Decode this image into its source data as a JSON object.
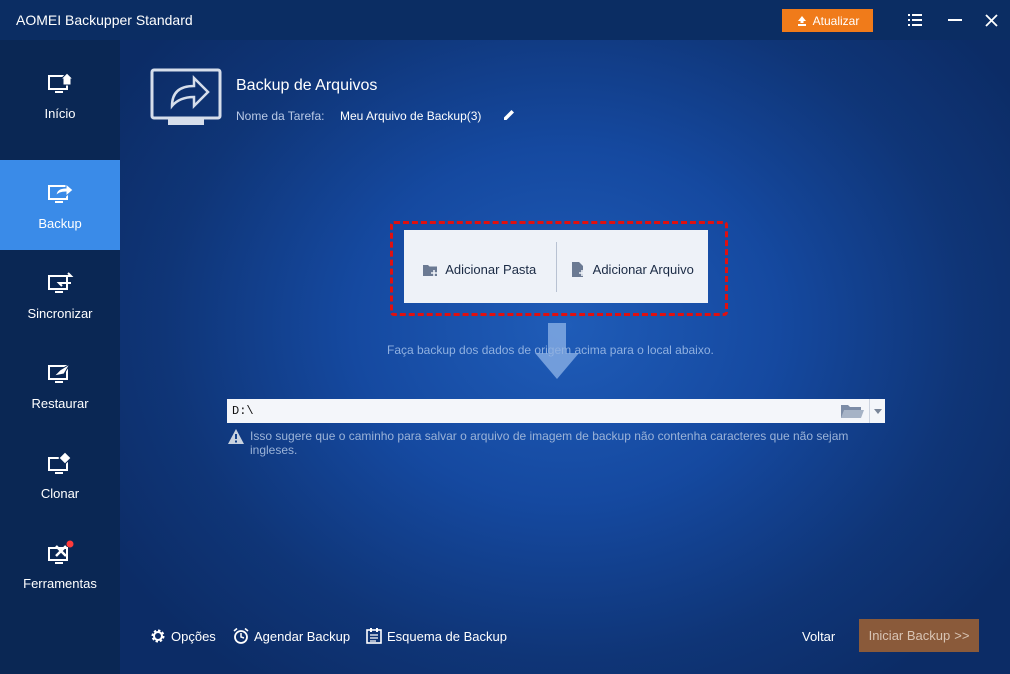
{
  "titlebar": {
    "app_title": "AOMEI Backupper Standard",
    "update_label": "Atualizar"
  },
  "sidebar": {
    "items": [
      {
        "label": "Início",
        "icon": "home-monitor-icon"
      },
      {
        "label": "Backup",
        "icon": "backup-monitor-icon",
        "active": true
      },
      {
        "label": "Sincronizar",
        "icon": "sync-monitor-icon"
      },
      {
        "label": "Restaurar",
        "icon": "restore-monitor-icon"
      },
      {
        "label": "Clonar",
        "icon": "clone-monitor-icon"
      },
      {
        "label": "Ferramentas",
        "icon": "tools-monitor-icon"
      }
    ]
  },
  "main": {
    "title": "Backup de Arquivos",
    "task_label": "Nome da Tarefa:",
    "task_name": "Meu Arquivo de Backup(3)",
    "source": {
      "add_folder_label": "Adicionar Pasta",
      "add_file_label": "Adicionar Arquivo"
    },
    "hint": "Faça backup dos dados de origem acima para o local abaixo.",
    "destination": {
      "value": "D:\\"
    },
    "warning": "Isso sugere que o caminho para salvar o arquivo de imagem de backup não contenha caracteres que não sejam ingleses."
  },
  "footer": {
    "options_label": "Opções",
    "schedule_label": "Agendar Backup",
    "scheme_label": "Esquema de Backup",
    "back_label": "Voltar",
    "start_label": "Iniciar Backup",
    "start_chevron": ">>"
  },
  "colors": {
    "accent": "#3a8be8",
    "update_button": "#f07b1a",
    "start_button": "#8a5a3a",
    "highlight_frame": "#e01010"
  }
}
